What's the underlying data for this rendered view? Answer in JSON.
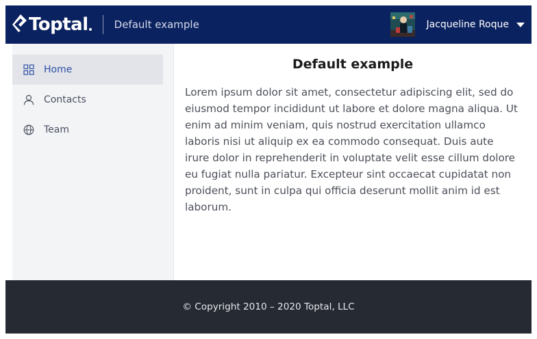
{
  "header": {
    "logo_text": "Toptal",
    "title": "Default example",
    "user_name": "Jacqueline Roque"
  },
  "sidebar": {
    "items": [
      {
        "label": "Home",
        "icon": "grid-icon",
        "active": true
      },
      {
        "label": "Contacts",
        "icon": "person-icon",
        "active": false
      },
      {
        "label": "Team",
        "icon": "globe-icon",
        "active": false
      }
    ]
  },
  "main": {
    "title": "Default example",
    "body": "Lorem ipsum dolor sit amet, consectetur adipiscing elit, sed do eiusmod tempor incididunt ut labore et dolore magna aliqua. Ut enim ad minim veniam, quis nostrud exercitation ullamco laboris nisi ut aliquip ex ea commodo consequat. Duis aute irure dolor in reprehenderit in voluptate velit esse cillum dolore eu fugiat nulla pariatur. Excepteur sint occaecat cupidatat non proident, sunt in culpa qui officia deserunt mollit anim id est laborum."
  },
  "footer": {
    "copyright": "© Copyright 2010 – 2020 Toptal, LLC"
  },
  "colors": {
    "header_bg": "#0b2260",
    "sidebar_bg": "#f3f4f6",
    "active_item_bg": "#e2e4e9",
    "active_accent": "#2e4fa6",
    "footer_bg": "#262a33"
  }
}
